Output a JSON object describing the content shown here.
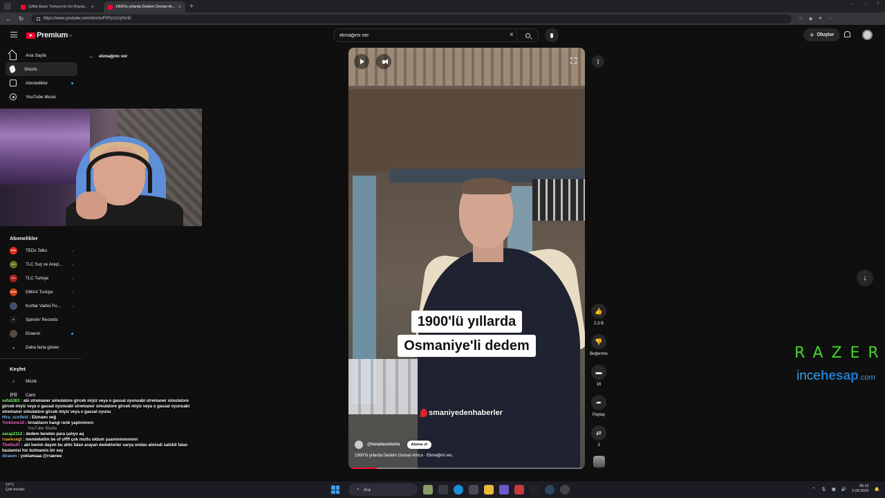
{
  "browser": {
    "tabs": [
      {
        "title": "Çiftlik Basic Türkiye'nin En Büyük...",
        "active": false
      },
      {
        "title": "1900'lü yıllarda Dedem Osman Ar...",
        "active": true
      }
    ],
    "url": "https://www.youtube.com/shorts/P0Fp1zUySmE"
  },
  "header": {
    "logo_text": "Premium",
    "logo_sup": "TR",
    "search_value": "ekmağımı ver",
    "create_label": "Oluştur"
  },
  "sidebar": {
    "items": [
      {
        "label": "Ana Sayfa",
        "icon": "home-icon"
      },
      {
        "label": "Shorts",
        "icon": "shorts-icon"
      },
      {
        "label": "Abonelikler",
        "icon": "subscriptions-icon"
      },
      {
        "label": "YouTube Music",
        "icon": "music-icon"
      }
    ],
    "subscriptions_title": "Abonelikler",
    "subscriptions": [
      {
        "name": "TEDx Talks",
        "color": "#e62b1e",
        "badge": "TEDx"
      },
      {
        "name": "TLC Suç ve Araşt...",
        "color": "#6a6a20",
        "badge": "TLC"
      },
      {
        "name": "TLC Turkiye",
        "color": "#b02020",
        "badge": "TLC"
      },
      {
        "name": "DMAX Turkiye",
        "color": "#d04010",
        "badge": "DMAX"
      },
      {
        "name": "Kurtlar Vadisi Pu...",
        "color": "#40506a",
        "badge": ""
      },
      {
        "name": "Spinnin' Records",
        "color": "#1c1c1c",
        "badge": "S"
      },
      {
        "name": "Elraenn",
        "color": "#5a4a40",
        "badge": ""
      },
      {
        "name": "Daha fazla göster",
        "color": "",
        "badge": ""
      }
    ],
    "explore_title": "Keşfet",
    "explore": [
      {
        "label": "Müzik",
        "icon": "music-note-icon"
      },
      {
        "label": "Canlı",
        "icon": "live-icon"
      }
    ]
  },
  "back_label": "ekmağımı ver",
  "chat": [
    {
      "user": "sefa5363",
      "msg": "abi stremaner simulatore gircek miyiz veya o gassal oyunuabi stremaner simulatore gircek miyiz veya o gassal oyunuabi stremaner simulatore gircek miyiz veya o gassal oyunuabi stremaner simulatore gircek miyiz veya o gassal oyunu"
    },
    {
      "user": "Hira_scofield",
      "msg": "Ekmamı veğ"
    },
    {
      "user": "Yorkinne10",
      "msg": "tırnakların hangi renk yaptınnnnn"
    },
    {
      "user": "sarap2112",
      "msg": "dedem benden para çalıyo aq"
    },
    {
      "user": "rraeiesegt",
      "msg": "memleketim be of offff çok mutlu oldum şuannnnnnnnnn"
    },
    {
      "user": "Thelhu47",
      "msg": "abi benim dayım bu altın falan arayan dedektorler varya ondan almisdi sahildi falan baslamisi hic bulmamis bir sey"
    },
    {
      "user": "dlraeen",
      "msg": "yoklamaaa @rraenee"
    }
  ],
  "chat_overlap": [
    "YouTube Studio"
  ],
  "video": {
    "caption_line1": "1900'lü yıllarda",
    "caption_line2": "Osmaniye'li dedem",
    "watermark": "smaniyedenhaberler",
    "channel": "@tunahanshorts",
    "subscribe_label": "Abone ol",
    "title": "1900'lü yıllarda Dedem Osman Amca · Ekmeğimi ver..",
    "progress": 0.12
  },
  "actions": {
    "like_count": "2,3 B",
    "dislike_label": "Beğenme",
    "comment_count": "16",
    "share_label": "Paylaş",
    "remix_count": "3"
  },
  "overlay": {
    "razer": "RAZER",
    "ince": "ince",
    "hesap": "hesap",
    "com": ".com"
  },
  "taskbar": {
    "weather_temp": "19°C",
    "weather_desc": "Çok bulutlu",
    "search_placeholder": "Ara",
    "time": "08:15",
    "date": "3.08.2025"
  },
  "colors": {
    "accent": "#ff0033",
    "razer_green": "#44d62c",
    "incehesap_blue": "#3aa0e6"
  }
}
